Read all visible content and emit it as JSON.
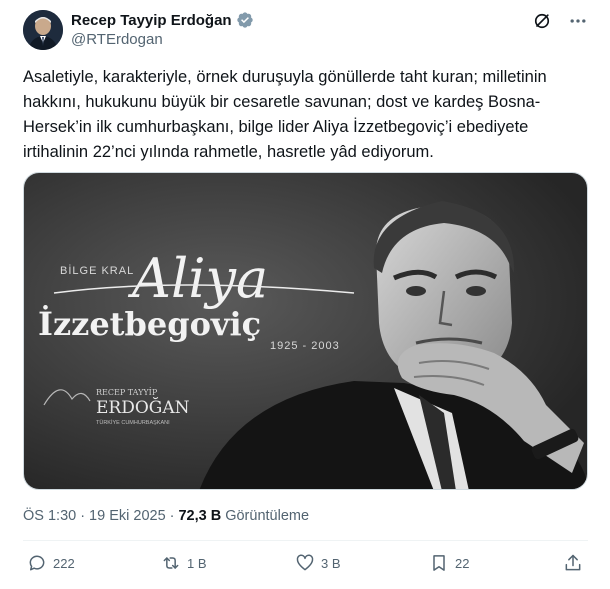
{
  "author": {
    "display_name": "Recep Tayyip Erdoğan",
    "handle": "@RTErdogan",
    "verified": true,
    "avatar_icon": "profile-photo"
  },
  "top_actions": {
    "grok_icon": "grok-icon",
    "more_icon": "more-icon"
  },
  "post": {
    "text": "Asaletiyle, karakteriyle, örnek duruşuyla gönüllerde taht kuran; milletinin hakkını, hukukunu büyük bir cesaretle savunan; dost ve kardeş Bosna-Hersek’in ilk cumhurbaşkanı, bilge lider Aliya İzzetbegoviç’i ebediyete irtihalinin 22’nci yılında rahmetle, hasretle yâd ediyorum."
  },
  "media": {
    "eyebrow": "BİLGE KRAL",
    "script_name": "Aliya",
    "surname": "İzzetbegoviç",
    "years": "1925 - 2003",
    "sig_line1": "RECEP TAYYİP",
    "sig_line2": "ERDOĞAN",
    "sig_line3": "TÜRKİYE CUMHURBAŞKANI"
  },
  "meta": {
    "time": "ÖS 1:30",
    "sep": "·",
    "date": "19 Eki 2025",
    "sep2": "·",
    "views": "72,3 B",
    "views_label": "Görüntüleme"
  },
  "actions": {
    "replies": "222",
    "reposts": "1 B",
    "likes": "3 B",
    "bookmarks": "22"
  },
  "colors": {
    "text": "#0f1419",
    "secondary": "#536471",
    "verified": "#829aab",
    "border": "#cfd9de",
    "divider": "#eff3f4"
  }
}
